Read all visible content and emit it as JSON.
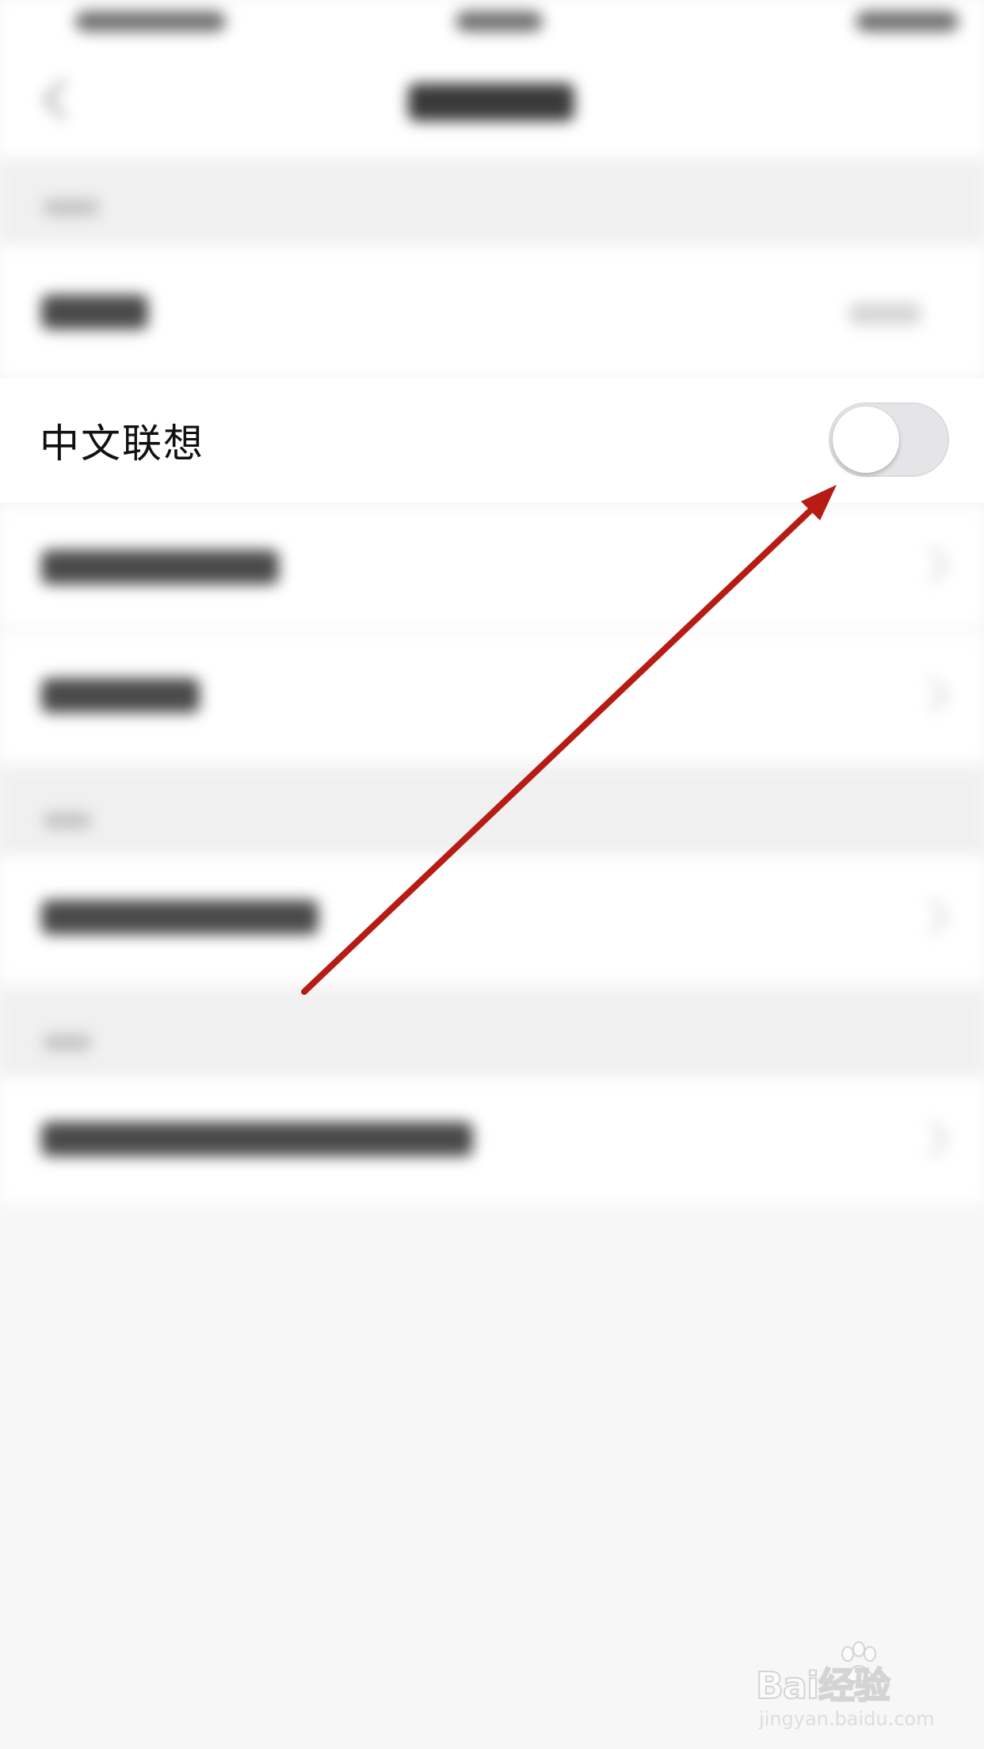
{
  "settings": {
    "chinese_association": {
      "label": "中文联想",
      "enabled": false
    }
  },
  "annotation": {
    "arrow_color": "#b71c14"
  },
  "watermark": {
    "brand": "Bai经验",
    "url": "jingyan.baidu.com"
  },
  "colors": {
    "background": "#f7f7f7",
    "row_background": "#ffffff",
    "toggle_off": "#e5e5e8"
  }
}
